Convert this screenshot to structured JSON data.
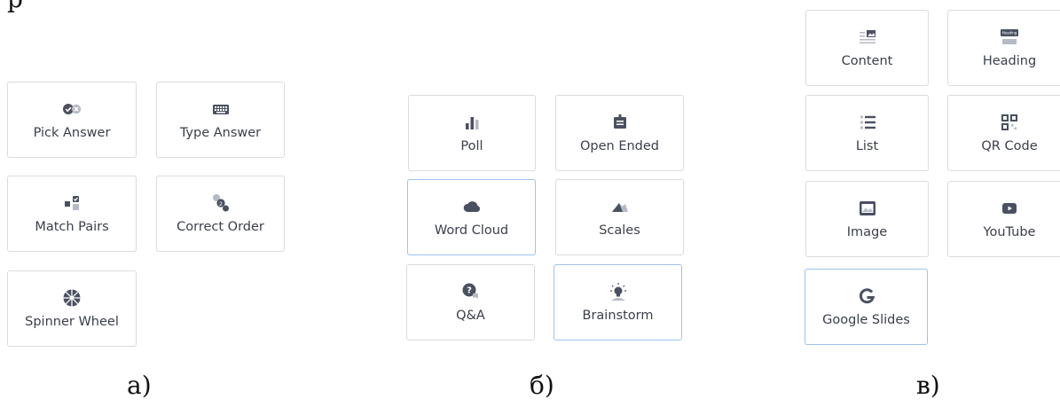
{
  "heading_fragment": "p",
  "panels": [
    {
      "caption": "а)",
      "tiles": [
        {
          "label": "Pick Answer",
          "icon": "check-cross-icon"
        },
        {
          "label": "Type Answer",
          "icon": "keyboard-icon"
        },
        {
          "label": "Match Pairs",
          "icon": "match-pairs-icon"
        },
        {
          "label": "Correct Order",
          "icon": "numbered-order-icon"
        },
        {
          "label": "Spinner Wheel",
          "icon": "spinner-wheel-icon"
        }
      ]
    },
    {
      "caption": "б)",
      "tiles": [
        {
          "label": "Poll",
          "icon": "bar-chart-icon"
        },
        {
          "label": "Open Ended",
          "icon": "open-ended-icon"
        },
        {
          "label": "Word Cloud",
          "icon": "cloud-icon",
          "selected": true
        },
        {
          "label": "Scales",
          "icon": "mountain-icon"
        },
        {
          "label": "Q&A",
          "icon": "question-bubble-icon"
        },
        {
          "label": "Brainstorm",
          "icon": "lightbulb-icon",
          "selected": true
        }
      ]
    },
    {
      "caption": "в)",
      "tiles": [
        {
          "label": "Content",
          "icon": "content-icon"
        },
        {
          "label": "Heading",
          "icon": "heading-icon",
          "badge": "Heading"
        },
        {
          "label": "List",
          "icon": "list-icon"
        },
        {
          "label": "QR Code",
          "icon": "qr-code-icon"
        },
        {
          "label": "Image",
          "icon": "image-icon"
        },
        {
          "label": "YouTube",
          "icon": "youtube-icon"
        },
        {
          "label": "Google Slides",
          "icon": "google-g-icon",
          "selected": true
        }
      ]
    }
  ]
}
